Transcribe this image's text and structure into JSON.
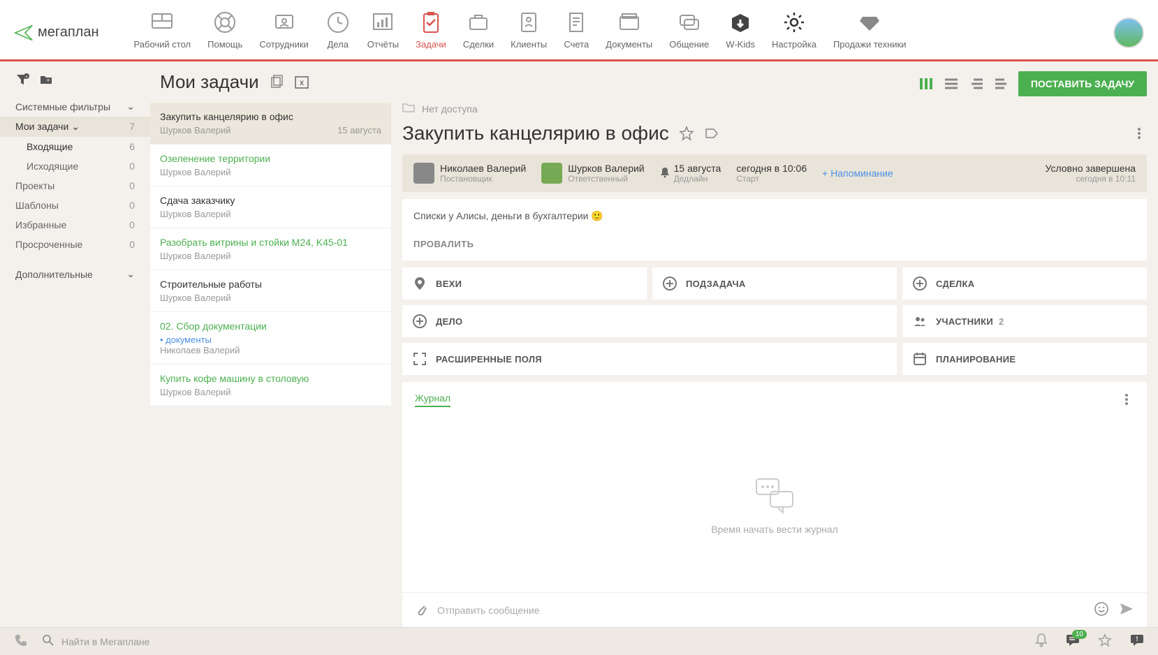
{
  "brand": "мегаплан",
  "nav": [
    {
      "label": "Рабочий стол"
    },
    {
      "label": "Помощь"
    },
    {
      "label": "Сотрудники"
    },
    {
      "label": "Дела"
    },
    {
      "label": "Отчёты"
    },
    {
      "label": "Задачи"
    },
    {
      "label": "Сделки"
    },
    {
      "label": "Клиенты"
    },
    {
      "label": "Счета"
    },
    {
      "label": "Документы"
    },
    {
      "label": "Общение"
    },
    {
      "label": "W-Kids"
    },
    {
      "label": "Настройка"
    },
    {
      "label": "Продажи техники"
    }
  ],
  "sidebar": {
    "systemFilters": "Системные фильтры",
    "additional": "Дополнительные",
    "myTasks": {
      "label": "Мои задачи",
      "count": "7"
    },
    "incoming": {
      "label": "Входящие",
      "count": "6"
    },
    "outgoing": {
      "label": "Исходящие",
      "count": "0"
    },
    "projects": {
      "label": "Проекты",
      "count": "0"
    },
    "templates": {
      "label": "Шаблоны",
      "count": "0"
    },
    "favorites": {
      "label": "Избранные",
      "count": "0"
    },
    "overdue": {
      "label": "Просроченные",
      "count": "0"
    }
  },
  "listHeader": "Мои задачи",
  "tasks": [
    {
      "title": "Закупить канцелярию в офис",
      "author": "Шурков Валерий",
      "date": "15 августа",
      "green": false,
      "tag": ""
    },
    {
      "title": "Озеленение территории",
      "author": "Шурков Валерий",
      "date": "",
      "green": true,
      "tag": ""
    },
    {
      "title": "Сдача заказчику",
      "author": "Шурков Валерий",
      "date": "",
      "green": false,
      "tag": ""
    },
    {
      "title": "Разобрать витрины и стойки M24, K45-01",
      "author": "Шурков Валерий",
      "date": "",
      "green": true,
      "tag": ""
    },
    {
      "title": "Строительные работы",
      "author": "Шурков Валерий",
      "date": "",
      "green": false,
      "tag": ""
    },
    {
      "title": "02. Сбор документации",
      "author": "Николаев Валерий",
      "date": "",
      "green": true,
      "tag": "документы"
    },
    {
      "title": "Купить кофе машину в столовую",
      "author": "Шурков Валерий",
      "date": "",
      "green": true,
      "tag": ""
    }
  ],
  "detail": {
    "createBtn": "ПОСТАВИТЬ ЗАДАЧУ",
    "noAccess": "Нет доступа",
    "title": "Закупить канцелярию в офис",
    "creator": {
      "name": "Николаев Валерий",
      "role": "Постановщик"
    },
    "assignee": {
      "name": "Шурков Валерий",
      "role": "Ответственный"
    },
    "deadline": {
      "value": "15 августа",
      "label": "Дедлайн"
    },
    "start": {
      "value": "сегодня в 10:06",
      "label": "Старт"
    },
    "reminder": "+ Напоминание",
    "status": {
      "value": "Условно завершена",
      "label": "сегодня в 10:11"
    },
    "description": "Списки у Алисы, деньги в бухгалтерии 🙂",
    "failBtn": "ПРОВАЛИТЬ",
    "widgets": {
      "milestones": "ВЕХИ",
      "subtask": "ПОДЗАДАЧА",
      "deal": "СДЕЛКА",
      "todo": "ДЕЛО",
      "participants": "УЧАСТНИКИ",
      "participantsCount": "2",
      "extFields": "РАСШИРЕННЫЕ ПОЛЯ",
      "planning": "ПЛАНИРОВАНИЕ"
    },
    "journalTab": "Журнал",
    "journalEmpty": "Время начать вести журнал",
    "composePlaceholder": "Отправить сообщение"
  },
  "bottom": {
    "searchPlaceholder": "Найти в Мегаплане",
    "chatBadge": "10"
  }
}
